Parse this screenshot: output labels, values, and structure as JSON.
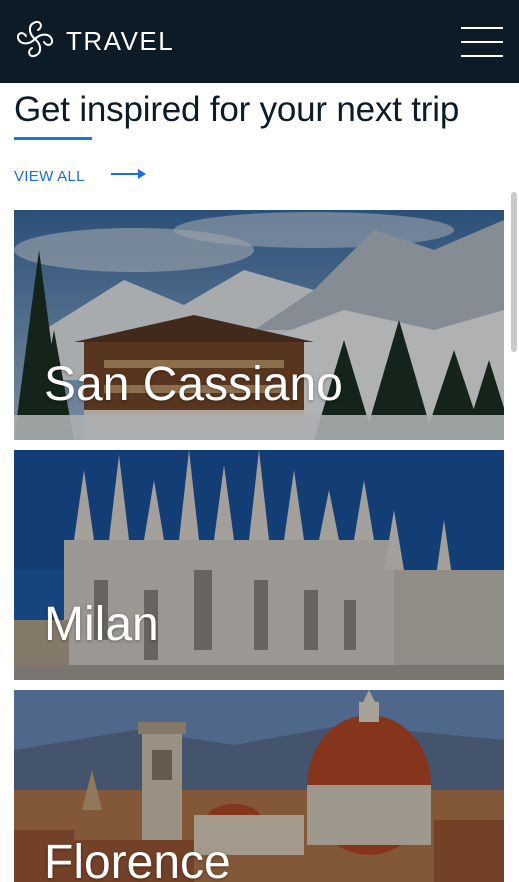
{
  "header": {
    "brand": "TRAVEL",
    "logo_icon": "pinwheel-logo-icon",
    "menu_icon": "hamburger-menu-icon"
  },
  "section": {
    "title": "Get inspired for your next trip",
    "view_all": "VIEW ALL",
    "view_all_icon": "arrow-right-icon"
  },
  "destinations": [
    {
      "name": "San Cassiano"
    },
    {
      "name": "Milan"
    },
    {
      "name": "Florence"
    }
  ],
  "colors": {
    "header_bg": "#0d1b27",
    "accent": "#1a73e8",
    "heading_text": "#0d1b27"
  }
}
